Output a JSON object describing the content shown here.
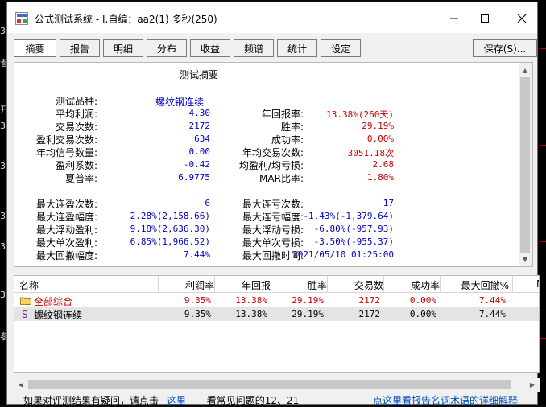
{
  "window": {
    "title": "公式测试系统 - I.自编：aa2(1) 多秒(250)"
  },
  "background": {
    "left_marks": [
      "3",
      "参",
      "开",
      "3",
      "3",
      "3",
      "3",
      "3",
      "参"
    ]
  },
  "tabs": [
    {
      "label": "摘要",
      "active": true
    },
    {
      "label": "报告",
      "active": false
    },
    {
      "label": "明细",
      "active": false
    },
    {
      "label": "分布",
      "active": false
    },
    {
      "label": "收益",
      "active": false
    },
    {
      "label": "频谱",
      "active": false
    },
    {
      "label": "统计",
      "active": false
    },
    {
      "label": "设定",
      "active": false
    }
  ],
  "save_label": "保存(S)...",
  "summary": {
    "title": "测试摘要",
    "left": [
      {
        "label": "测试品种:",
        "value": "螺纹钢连续",
        "color": "blue"
      },
      {
        "label": "平均利润:",
        "value": "4.30",
        "color": "blue"
      },
      {
        "label": "交易次数:",
        "value": "2172",
        "color": "blue"
      },
      {
        "label": "盈利交易次数:",
        "value": "634",
        "color": "blue"
      },
      {
        "label": "年均信号数量:",
        "value": "0.00",
        "color": "blue"
      },
      {
        "label": "盈利系数:",
        "value": "-0.42",
        "color": "blue"
      },
      {
        "label": "夏普率:",
        "value": "6.9775",
        "color": "blue"
      }
    ],
    "right": [
      {
        "label": "年回报率:",
        "value": "13.38%(260天)",
        "color": "red"
      },
      {
        "label": "胜率:",
        "value": "29.19%",
        "color": "red"
      },
      {
        "label": "成功率:",
        "value": "0.00%",
        "color": "red"
      },
      {
        "label": "年均交易次数:",
        "value": "3051.18次",
        "color": "red"
      },
      {
        "label": "均盈利/均亏损:",
        "value": "2.68",
        "color": "red"
      },
      {
        "label": "MAR比率:",
        "value": "1.80%",
        "color": "red"
      }
    ],
    "left2": [
      {
        "label": "最大连盈次数:",
        "value": "6"
      },
      {
        "label": "最大连盈幅度:",
        "value": "2.28%(2,158.66)"
      },
      {
        "label": "最大浮动盈利:",
        "value": "9.18%(2,636.30)"
      },
      {
        "label": "最大单次盈利:",
        "value": "6.85%(1,966.52)"
      },
      {
        "label": "最大回撤幅度:",
        "value": "7.44%"
      }
    ],
    "right2": [
      {
        "label": "最大连亏次数:",
        "value": "17"
      },
      {
        "label": "最大连亏幅度:",
        "value": "-1.43%(-1,379.64)"
      },
      {
        "label": "最大浮动亏损:",
        "value": "-6.80%(-957.93)"
      },
      {
        "label": "最大单次亏损:",
        "value": "-3.50%(-955.37)"
      },
      {
        "label": "最大回撤时间:",
        "value": "2021/05/10 01:25:00"
      }
    ]
  },
  "table": {
    "headers": [
      "名称",
      "利润率",
      "年回报",
      "胜率",
      "交易数",
      "成功率",
      "最大回撤%",
      "M"
    ],
    "rows": [
      {
        "name": "全部综合",
        "icon": "folder-icon",
        "cells": [
          "9.35%",
          "13.38%",
          "29.19%",
          "2172",
          "0.00%",
          "7.44%"
        ]
      },
      {
        "name": "螺纹钢连续",
        "icon": "s-icon",
        "cells": [
          "9.35%",
          "13.38%",
          "29.19%",
          "2172",
          "0.00%",
          "7.44%"
        ]
      }
    ]
  },
  "footer": {
    "text1": "如果对评测结果有疑问，请点击",
    "link1": "这里",
    "text2": "看常见问题的12、21",
    "link2": "点这里看报告名词术语的详细解释"
  }
}
